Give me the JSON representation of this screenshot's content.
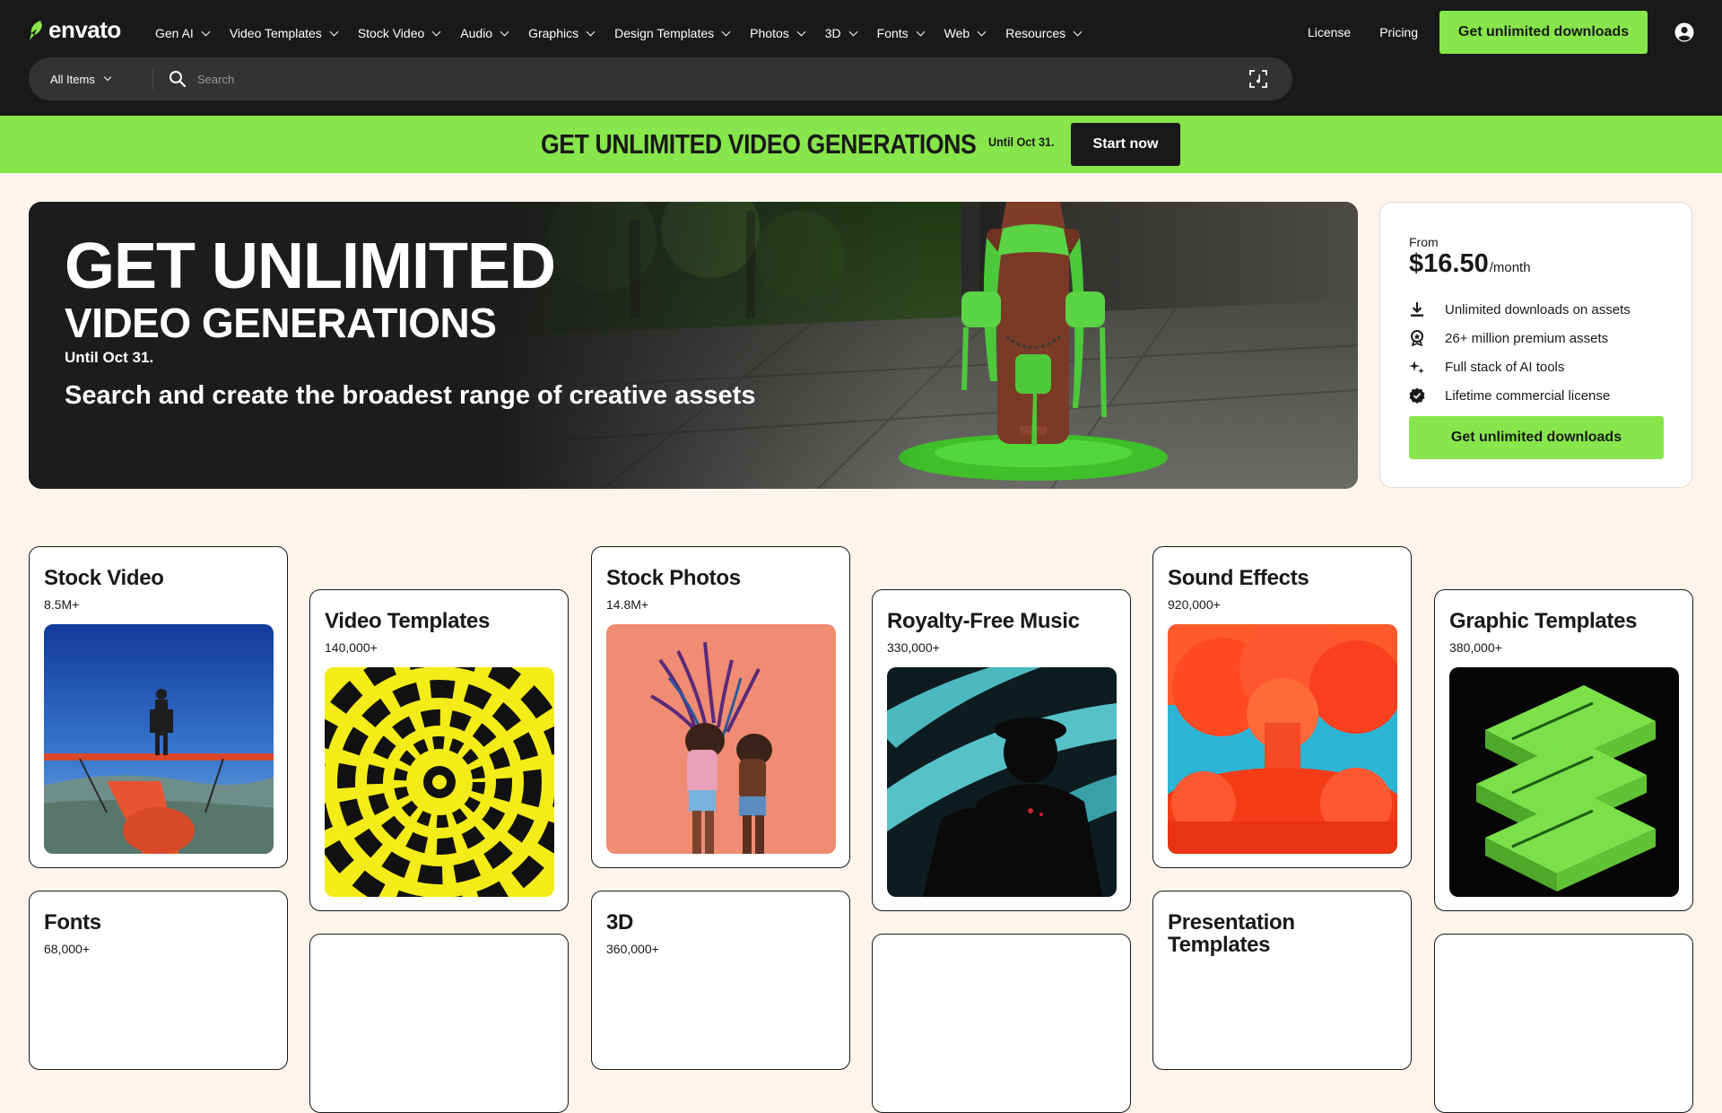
{
  "header": {
    "logo_text": "envato",
    "nav": [
      {
        "label": "Gen AI"
      },
      {
        "label": "Video Templates"
      },
      {
        "label": "Stock Video"
      },
      {
        "label": "Audio"
      },
      {
        "label": "Graphics"
      },
      {
        "label": "Design Templates"
      },
      {
        "label": "Photos"
      },
      {
        "label": "3D"
      },
      {
        "label": "Fonts"
      },
      {
        "label": "Web"
      },
      {
        "label": "Resources"
      }
    ],
    "license_label": "License",
    "pricing_label": "Pricing",
    "cta_label": "Get unlimited downloads"
  },
  "search": {
    "category_label": "All Items",
    "placeholder": "Search"
  },
  "promo": {
    "title": "GET UNLIMITED VIDEO GENERATIONS",
    "until": "Until Oct 31.",
    "button_label": "Start now"
  },
  "hero": {
    "line1": "GET UNLIMITED",
    "line2": "VIDEO GENERATIONS",
    "until": "Until Oct 31.",
    "subtitle": "Search and create the broadest range of creative assets"
  },
  "pricing": {
    "from_label": "From",
    "price": "$16.50",
    "period": "/month",
    "features": [
      {
        "icon": "download-icon",
        "text": "Unlimited downloads on assets"
      },
      {
        "icon": "award-icon",
        "text": "26+ million premium assets"
      },
      {
        "icon": "sparkles-icon",
        "text": "Full stack of AI tools"
      },
      {
        "icon": "verified-badge-icon",
        "text": "Lifetime commercial license"
      }
    ],
    "button_label": "Get unlimited downloads"
  },
  "categories": [
    {
      "title": "Stock Video",
      "count": "8.5M+"
    },
    {
      "title": "Video Templates",
      "count": "140,000+"
    },
    {
      "title": "Stock Photos",
      "count": "14.8M+"
    },
    {
      "title": "Royalty-Free Music",
      "count": "330,000+"
    },
    {
      "title": "Sound Effects",
      "count": "920,000+"
    },
    {
      "title": "Graphic Templates",
      "count": "380,000+"
    },
    {
      "title": "Fonts",
      "count": "68,000+"
    },
    {
      "title": "3D",
      "count": "360,000+"
    },
    {
      "title": "Presentation Templates",
      "count": ""
    }
  ],
  "colors": {
    "brand_green": "#87e64b",
    "header_bg": "#191919",
    "page_bg": "#fdf4ec"
  }
}
